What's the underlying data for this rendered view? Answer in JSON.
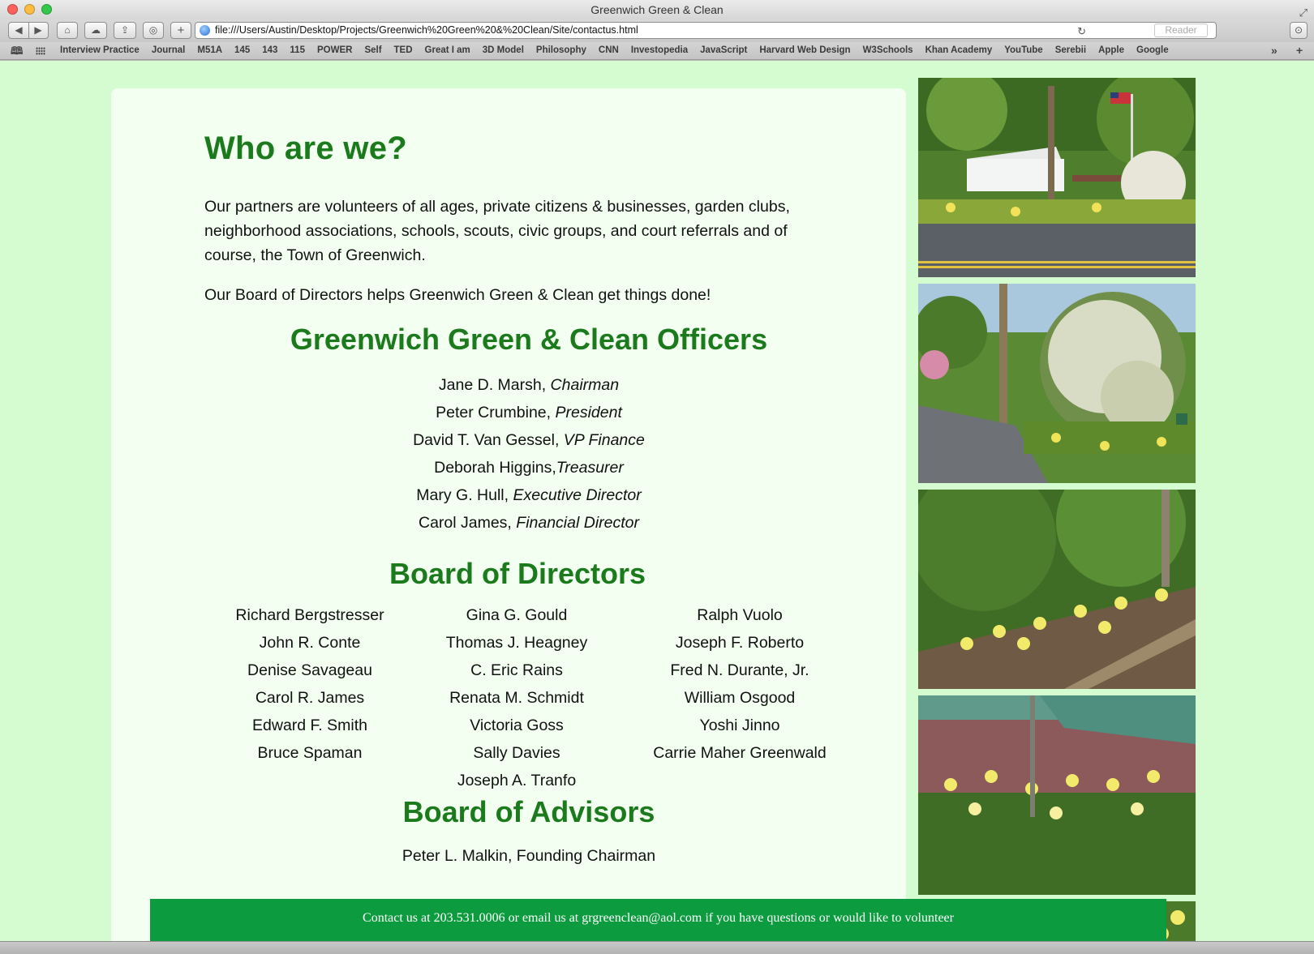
{
  "window": {
    "title": "Greenwich Green & Clean"
  },
  "toolbar": {
    "back_icon": "◀",
    "forward_icon": "▶",
    "home_icon": "⌂",
    "cloud_icon": "☁",
    "share_icon": "⇪",
    "reading_icon": "◎",
    "new_tab_icon": "+",
    "url": "file:///Users/Austin/Desktop/Projects/Greenwich%20Green%20&%20Clean/Site/contactus.html",
    "reload_icon": "↻",
    "reader_label": "Reader",
    "download_icon": "⊙"
  },
  "bookmarks": {
    "items": [
      "Interview Practice",
      "Journal",
      "M51A",
      "145",
      "143",
      "115",
      "POWER",
      "Self",
      "TED",
      "Great I am",
      "3D Model",
      "Philosophy",
      "CNN",
      "Investopedia",
      "JavaScript",
      "Harvard Web Design",
      "W3Schools",
      "Khan Academy",
      "YouTube",
      "Serebii",
      "Apple",
      "Google"
    ],
    "more_icon": "»",
    "add_icon": "+"
  },
  "page": {
    "heading": "Who are we?",
    "para1": "Our partners are volunteers of all ages, private citizens & businesses, garden clubs, neighborhood associations, schools, scouts, civic groups, and court referrals and of course, the Town of Greenwich.",
    "para2": "Our Board of Directors helps Greenwich Green & Clean get things done!",
    "officers_heading": "Greenwich Green & Clean Officers",
    "officers": [
      {
        "name": "Jane D. Marsh, ",
        "title": "Chairman"
      },
      {
        "name": "Peter Crumbine, ",
        "title": "President"
      },
      {
        "name": "David T. Van Gessel, ",
        "title": "VP Finance"
      },
      {
        "name": "Deborah Higgins,",
        "title": "Treasurer"
      },
      {
        "name": "Mary G. Hull, ",
        "title": "Executive Director"
      },
      {
        "name": "Carol James, ",
        "title": "Financial Director"
      }
    ],
    "board_heading": "Board of Directors",
    "board_columns": [
      [
        "Richard Bergstresser",
        "John R. Conte",
        "Denise Savageau",
        "Carol R. James",
        "Edward F. Smith",
        "Bruce Spaman"
      ],
      [
        "Gina G. Gould",
        "Thomas J. Heagney",
        "C. Eric Rains",
        "Renata M. Schmidt",
        "Victoria Goss",
        "Sally Davies",
        "Joseph A. Tranfo"
      ],
      [
        "Ralph Vuolo",
        "Joseph F. Roberto",
        "Fred N. Durante, Jr.",
        "William Osgood",
        "Yoshi Jinno",
        "Carrie Maher Greenwald"
      ]
    ],
    "advisors_heading": "Board of Advisors",
    "advisors": [
      "Peter L. Malkin, Founding Chairman"
    ],
    "footer": "Contact us at 203.531.0006 or email us at grgreenclean@aol.com if you have questions or would like to volunteer"
  },
  "colors": {
    "page_background": "#d4fcd0",
    "card_background": "#f2fff1",
    "heading_green": "#1b7a1b",
    "footer_green": "#0d9b3f"
  }
}
